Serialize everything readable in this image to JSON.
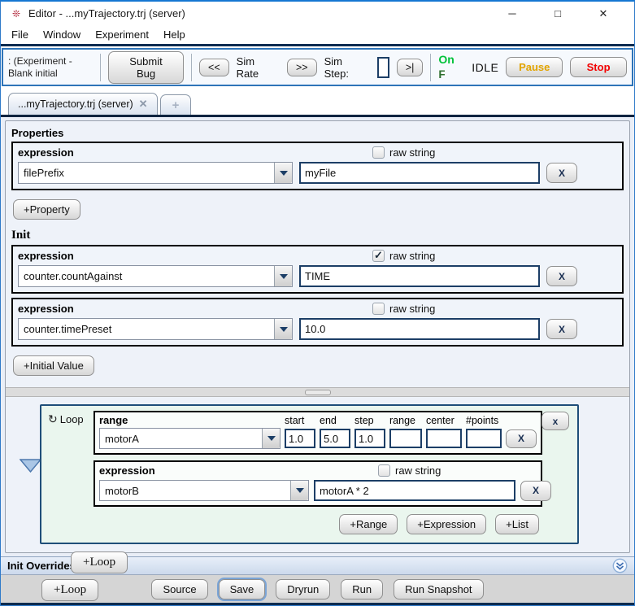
{
  "window": {
    "title": "Editor - ...myTrajectory.trj (server)",
    "icon_glyph": "❊",
    "controls": {
      "minimize": "─",
      "maximize": "□",
      "close": "✕"
    }
  },
  "menu": {
    "items": [
      "File",
      "Window",
      "Experiment",
      "Help"
    ]
  },
  "toolbar": {
    "experiment_line1": ": (Experiment -",
    "experiment_line2": "Blank initial",
    "submit_bug": "Submit Bug",
    "rate_down": "<<",
    "sim_rate": "Sim Rate",
    "rate_up": ">>",
    "sim_step_label": "Sim Step:",
    "sim_step_value": "",
    "step_once": ">|",
    "on_label": "On",
    "on_clipped": "F",
    "idle": "IDLE",
    "pause": "Pause",
    "stop": "Stop"
  },
  "tabs": {
    "active_label": "...myTrajectory.trj (server)",
    "close_glyph": "✕",
    "add_glyph": "+"
  },
  "properties": {
    "heading": "Properties",
    "row": {
      "type": "expression",
      "target": "filePrefix",
      "raw_label": "raw string",
      "raw_checked": false,
      "value": "myFile",
      "remove": "X"
    },
    "add": "+Property"
  },
  "init": {
    "heading": "Init",
    "rows": [
      {
        "type": "expression",
        "target": "counter.countAgainst",
        "raw_label": "raw string",
        "raw_checked": true,
        "value": "TIME",
        "remove": "X"
      },
      {
        "type": "expression",
        "target": "counter.timePreset",
        "raw_label": "raw string",
        "raw_checked": false,
        "value": "10.0",
        "remove": "X"
      }
    ],
    "add": "+Initial Value"
  },
  "loop": {
    "icon": "↻",
    "label": "Loop",
    "close": "x",
    "range": {
      "heading": "range",
      "target": "motorA",
      "headers": [
        "start",
        "end",
        "step",
        "range",
        "center",
        "#points"
      ],
      "values": [
        "1.0",
        "5.0",
        "1.0",
        "",
        "",
        ""
      ],
      "remove": "X"
    },
    "expression": {
      "heading": "expression",
      "target": "motorB",
      "raw_label": "raw string",
      "raw_checked": false,
      "value": "motorA * 2",
      "remove": "X"
    },
    "add_range": "+Range",
    "add_expression": "+Expression",
    "add_list": "+List",
    "add_loop_inner": "+Loop",
    "add_loop_outer": "+Loop"
  },
  "init_overrides": {
    "heading": "Init Overrides"
  },
  "footer": {
    "buttons": [
      "Source",
      "Save",
      "Dryrun",
      "Run",
      "Run Snapshot"
    ]
  },
  "icons": {
    "check": "✓"
  },
  "colors": {
    "accent_blue": "#2e74b8",
    "field_border_navy": "#1c3e66",
    "on_green": "#00c23a",
    "pause_orange": "#e2a400",
    "stop_red": "#f20000",
    "loop_panel_green": "#eaf6ee"
  }
}
